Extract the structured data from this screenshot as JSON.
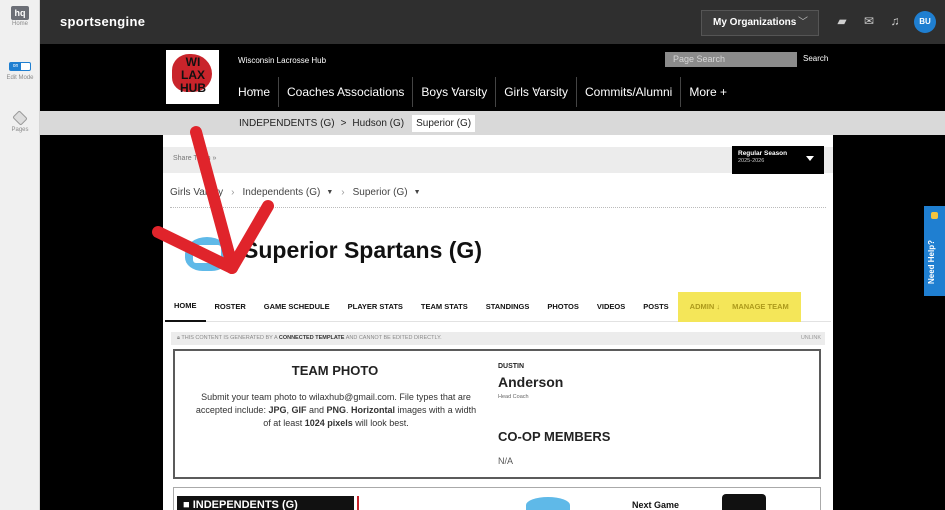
{
  "rail": {
    "home_badge": "hq",
    "home_label": "Home",
    "edit_toggle": "on",
    "edit_label": "Edit Mode",
    "pages_label": "Pages"
  },
  "topbar": {
    "brand": "sportsengine",
    "org_menu": "My Organizations",
    "avatar_initials": "BU"
  },
  "site": {
    "logo_text": "WI LAX HUB",
    "title": "Wisconsin Lacrosse Hub",
    "search_placeholder": "Page Search",
    "search_button": "Search",
    "nav": [
      "Home",
      "Coaches Associations",
      "Boys Varsity",
      "Girls Varsity",
      "Commits/Alumni",
      "More +"
    ]
  },
  "breadcrumb": [
    "INDEPENDENTS (G)",
    ">",
    "Hudson (G)",
    "Superior (G)"
  ],
  "share": {
    "text": "Share   Team »",
    "season_title": "Regular Season",
    "season_years": "2025-2026"
  },
  "teamnav": {
    "level1": "Girls Varsity",
    "level2": "Independents (G)",
    "level3": "Superior (G)"
  },
  "team": {
    "name": "Superior Spartans (G)"
  },
  "tabs": [
    "HOME",
    "ROSTER",
    "GAME SCHEDULE",
    "PLAYER STATS",
    "TEAM STATS",
    "STANDINGS",
    "PHOTOS",
    "VIDEOS",
    "POSTS"
  ],
  "admin_tabs": [
    "ADMIN ↓",
    "MANAGE TEAM"
  ],
  "notice": {
    "prefix": "THIS CONTENT IS GENERATED BY A",
    "bold": "CONNECTED TEMPLATE",
    "suffix": "AND CANNOT BE EDITED DIRECTLY.",
    "unlink": "UNLINK"
  },
  "team_photo": {
    "title": "TEAM PHOTO",
    "line1": "Submit your team photo to wilaxhub@gmail.com. File types that are",
    "line2a": "accepted include: ",
    "jpg": "JPG",
    "sep1": ", ",
    "gif": "GIF",
    "sep2": " and ",
    "png": "PNG",
    "sep3": ". ",
    "horizontal": "Horizontal",
    "line2b": " images with a width",
    "line3a": "of at least ",
    "pixels": "1024 pixels",
    "line3b": " will look best."
  },
  "coach": {
    "first": "DUSTIN",
    "last": "Anderson",
    "role": "Head Coach"
  },
  "coop": {
    "title": "CO-OP MEMBERS",
    "value": "N/A"
  },
  "bottom": {
    "banner": "INDEPENDENTS (G)",
    "next_game": "Next Game"
  },
  "help": {
    "label": "Need Help?"
  },
  "colors": {
    "accent_blue": "#1f7fd1",
    "admin_yellow": "#f4e659",
    "arrow_red": "#e0242b",
    "brand_red": "#c9242b"
  }
}
